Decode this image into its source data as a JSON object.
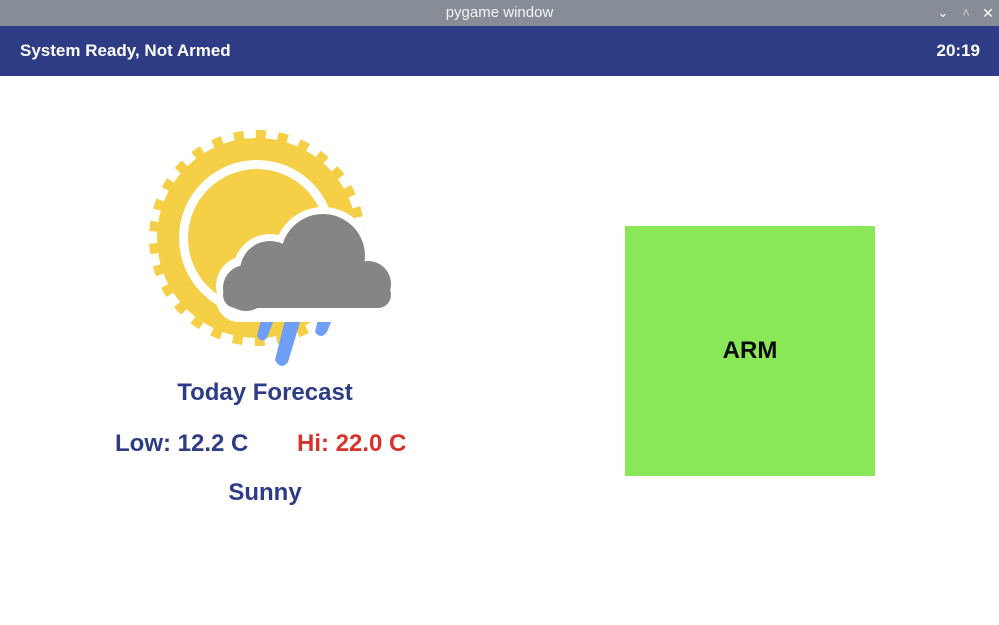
{
  "window": {
    "title": "pygame window",
    "controls": {
      "minimize": "⌄",
      "maximize": "˄",
      "close": "✕"
    }
  },
  "status_bar": {
    "status": "System Ready, Not Armed",
    "time": "20:19",
    "background": "#2e3c86"
  },
  "forecast": {
    "icon": "sun-cloud-rain-icon",
    "title": "Today Forecast",
    "low": "Low: 12.2 C",
    "high": "Hi: 22.0 C",
    "condition": "Sunny"
  },
  "arm_button": {
    "label": "ARM",
    "color": "#8ae858"
  },
  "colors": {
    "text_primary": "#2e3c86",
    "text_high": "#d8332a",
    "sun": "#f5cf45",
    "cloud": "#858585",
    "rain": "#6e9ef5"
  }
}
